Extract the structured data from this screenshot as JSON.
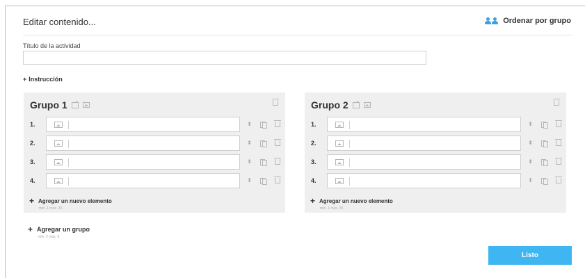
{
  "header": {
    "title": "Editar contenido...",
    "order_button": "Ordenar por grupo"
  },
  "form": {
    "title_label": "Título de la actividad",
    "title_value": "",
    "title_placeholder": "",
    "instruction_link": "Instrucción"
  },
  "groups": [
    {
      "title": "Grupo 1",
      "items": [
        {
          "num": "1."
        },
        {
          "num": "2."
        },
        {
          "num": "3."
        },
        {
          "num": "4."
        }
      ],
      "add_label": "Agregar un nuevo elemento",
      "limit_text": "mín. 1 máx. 20"
    },
    {
      "title": "Grupo 2",
      "items": [
        {
          "num": "1."
        },
        {
          "num": "2."
        },
        {
          "num": "3."
        },
        {
          "num": "4."
        }
      ],
      "add_label": "Agregar un nuevo elemento",
      "limit_text": "mín. 1 máx. 20"
    }
  ],
  "add_group": {
    "label": "Agregar un grupo",
    "limit_text": "mín. 2 máx. 8"
  },
  "done_button": "Listo",
  "colors": {
    "accent": "#3fb6f2",
    "panel": "#efefef"
  }
}
